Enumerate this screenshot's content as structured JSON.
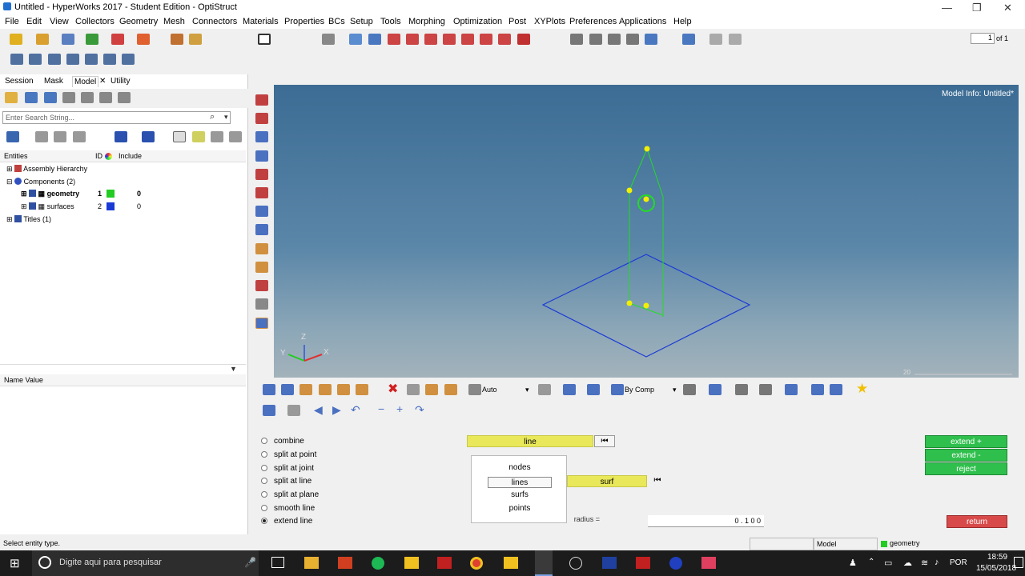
{
  "title": "Untitled - HyperWorks 2017 - Student Edition - OptiStruct",
  "window_controls": {
    "minimize": "—",
    "maximize": "❐",
    "close": "✕"
  },
  "menu": [
    "File",
    "Edit",
    "View",
    "Collectors",
    "Geometry",
    "Mesh",
    "Connectors",
    "Materials",
    "Properties",
    "BCs",
    "Setup",
    "Tools",
    "Morphing",
    "Optimization",
    "Post",
    "XYPlots",
    "Preferences",
    "Applications",
    "Help"
  ],
  "page_nav": {
    "value": "1",
    "total": "of 1"
  },
  "browser_tabs": [
    "Session",
    "Mask",
    "Model",
    "Utility"
  ],
  "search_placeholder": "Enter Search String...",
  "entity_header": {
    "entities": "Entities",
    "id": "ID",
    "include": "Include"
  },
  "tree": {
    "assembly": "Assembly Hierarchy",
    "components": "Components (2)",
    "geometry": {
      "name": "geometry",
      "id": "1",
      "include": "0",
      "color": "#22cc22"
    },
    "surfaces": {
      "name": "surfaces",
      "id": "2",
      "include": "0",
      "color": "#1a3ad6"
    },
    "titles": "Titles (1)"
  },
  "name_value_header": "Name Value",
  "model_info": "Model Info: Untitled*",
  "scale_label": "20",
  "triad": {
    "z": "Z",
    "y": "Y",
    "x": "X"
  },
  "vis_toolbar": {
    "auto": "Auto",
    "bycomp": "By Comp"
  },
  "radio_options": [
    {
      "label": "combine",
      "checked": false
    },
    {
      "label": "split at point",
      "checked": false
    },
    {
      "label": "split at joint",
      "checked": false
    },
    {
      "label": "split at line",
      "checked": false
    },
    {
      "label": "split at plane",
      "checked": false
    },
    {
      "label": "smooth line",
      "checked": false
    },
    {
      "label": "extend line",
      "checked": true
    }
  ],
  "line_selector": "line",
  "surf_selector": "surf",
  "popup_options": [
    "nodes",
    "lines",
    "surfs",
    "points"
  ],
  "radius_label": "radius =",
  "vector_value": "0 . 1 0 0",
  "buttons": {
    "extend_plus": "extend +",
    "extend_minus": "extend -",
    "reject": "reject",
    "return": "return"
  },
  "status": {
    "message": "Select entity type.",
    "model": "Model",
    "component": "geometry"
  },
  "taskbar": {
    "search": "Digite aqui para pesquisar",
    "lang": "POR",
    "time": "18:59",
    "date": "15/05/2018"
  },
  "colors": {
    "accent_green": "#2fbf4d",
    "return_red": "#d84a4a",
    "selector_yellow": "#e8e85a"
  }
}
